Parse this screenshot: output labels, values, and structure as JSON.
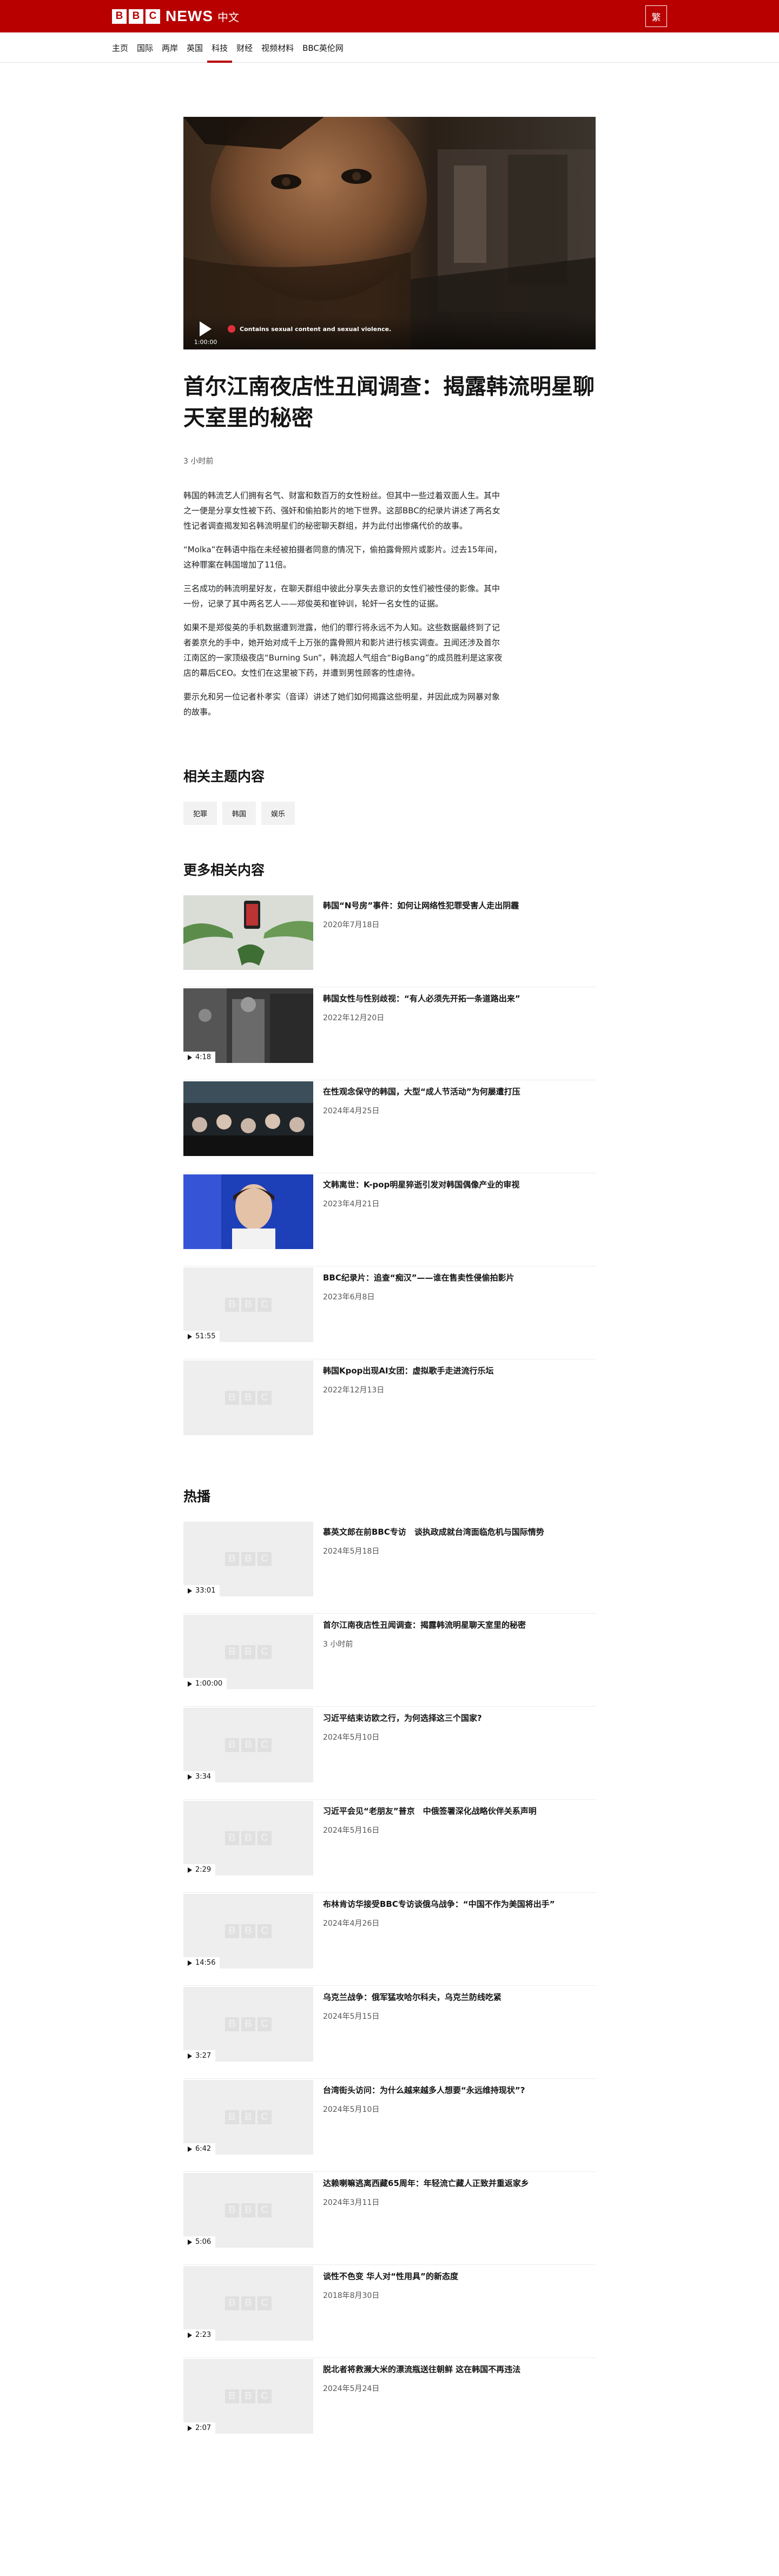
{
  "header": {
    "brand_letters": [
      "B",
      "B",
      "C"
    ],
    "brand_news": "NEWS",
    "brand_lang": "中文",
    "script_toggle": "繁"
  },
  "nav": {
    "items": [
      "主页",
      "国际",
      "两岸",
      "英国",
      "科技",
      "财经",
      "视频材料",
      "BBC英伦网"
    ]
  },
  "hero": {
    "duration": "1:00:00",
    "warning": "Contains sexual content and sexual violence."
  },
  "article": {
    "title": "首尔江南夜店性丑闻调查：揭露韩流明星聊天室里的秘密",
    "timestamp": "3 小时前",
    "paragraphs": [
      "韩国的韩流艺人们拥有名气、财富和数百万的女性粉丝。但其中一些过着双面人生。其中之一便是分享女性被下药、强奸和偷拍影片的地下世界。这部BBC的纪录片讲述了两名女性记者调查揭发知名韩流明星们的秘密聊天群组，并为此付出惨痛代价的故事。",
      "“Molka”在韩语中指在未经被拍摄者同意的情况下，偷拍露骨照片或影片。过去15年间，这种罪案在韩国增加了11倍。",
      "三名成功的韩流明星好友，在聊天群组中彼此分享失去意识的女性们被性侵的影像。其中一份，记录了其中两名艺人——郑俊英和崔钟训，轮奸一名女性的证据。",
      "如果不是郑俊英的手机数据遭到泄露，他们的罪行将永远不为人知。这些数据最终到了记者姜京允的手中，她开始对成千上万张的露骨照片和影片进行核实调查。丑闻还涉及首尔江南区的一家顶级夜店“Burning Sun”，韩流超人气组合“BigBang”的成员胜利是这家夜店的幕后CEO。女性们在这里被下药，并遭到男性顾客的性虐待。",
      "要示允和另一位记者朴孝实（音译）讲述了她们如何揭露这些明星，并因此成为网暴对象的故事。"
    ]
  },
  "topics": {
    "heading": "相关主题内容",
    "tags": [
      "犯罪",
      "韩国",
      "娱乐"
    ]
  },
  "more": {
    "heading": "更多相关内容",
    "items": [
      {
        "headline": "韩国“N号房”事件：如何让网络性犯罪受害人走出阴霾",
        "date": "2020年7月18日",
        "duration": ""
      },
      {
        "headline": "韩国女性与性别歧视：“有人必须先开拓一条道路出来”",
        "date": "2022年12月20日",
        "duration": "4:18"
      },
      {
        "headline": "在性观念保守的韩国，大型“成人节活动”为何屡遭打压",
        "date": "2024年4月25日",
        "duration": ""
      },
      {
        "headline": "文韩离世：K-pop明星猝逝引发对韩国偶像产业的审视",
        "date": "2023年4月21日",
        "duration": ""
      },
      {
        "headline": "BBC纪录片：追查“痴汉”——谁在售卖性侵偷拍影片",
        "date": "2023年6月8日",
        "duration": "51:55"
      },
      {
        "headline": "韩国Kpop出现AI女团：虚拟歌手走进流行乐坛",
        "date": "2022年12月13日",
        "duration": ""
      }
    ]
  },
  "hot": {
    "heading": "热播",
    "items": [
      {
        "headline": "慕英文郎在前BBC专访　谈执政成就台湾面临危机与国际情势",
        "date": "2024年5月18日",
        "duration": "33:01"
      },
      {
        "headline": "首尔江南夜店性丑闻调查：揭露韩流明星聊天室里的秘密",
        "date": "3 小时前",
        "duration": "1:00:00"
      },
      {
        "headline": "习近平结束访欧之行，为何选择这三个国家?",
        "date": "2024年5月10日",
        "duration": "3:34"
      },
      {
        "headline": "习近平会见“老朋友”普京　中俄签署深化战略伙伴关系声明",
        "date": "2024年5月16日",
        "duration": "2:29"
      },
      {
        "headline": "布林肯访华接受BBC专访谈俄乌战争：“中国不作为美国将出手”",
        "date": "2024年4月26日",
        "duration": "14:56"
      },
      {
        "headline": "乌克兰战争：俄军猛攻哈尔科夫，乌克兰防线吃紧",
        "date": "2024年5月15日",
        "duration": "3:27"
      },
      {
        "headline": "台湾街头访问：为什么越来越多人想要“永远维持现状”?",
        "date": "2024年5月10日",
        "duration": "6:42"
      },
      {
        "headline": "达赖喇嘛逃离西藏65周年：年轻流亡藏人正致并重返家乡",
        "date": "2024年3月11日",
        "duration": "5:06"
      },
      {
        "headline": "谈性不色变 华人对“性用具”的新态度",
        "date": "2018年8月30日",
        "duration": "2:23"
      },
      {
        "headline": "脱北者将救濒大米的漂流瓶送往朝鲜 这在韩国不再违法",
        "date": "2024年5月24日",
        "duration": "2:07"
      }
    ]
  },
  "colors": {
    "brand_red": "#b80000",
    "text": "#141414",
    "muted": "#545658",
    "placeholder": "#eeeeee"
  }
}
